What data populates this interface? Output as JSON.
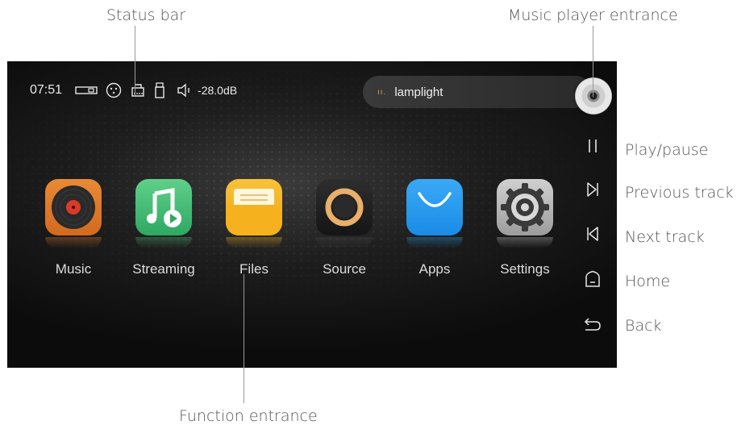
{
  "callouts": {
    "status_bar": "Status bar",
    "music_player_entrance": "Music player entrance",
    "function_entrance": "Function entrance",
    "play_pause": "Play/pause",
    "previous_track": "Previous track",
    "next_track": "Next track",
    "home": "Home",
    "back": "Back"
  },
  "status": {
    "time": "07:51",
    "icons": [
      "optical-input-icon",
      "xlr-input-icon",
      "network-icon",
      "usb-icon",
      "volume-icon"
    ],
    "volume": "-28.0dB"
  },
  "player": {
    "track": "lamplight",
    "eq_glyph": "ıı."
  },
  "apps": [
    {
      "label": "Music",
      "icon": "vinyl-record-icon",
      "color": "#e07a2a"
    },
    {
      "label": "Streaming",
      "icon": "music-note-play-icon",
      "color": "#4cbf7a"
    },
    {
      "label": "Files",
      "icon": "folder-icon",
      "color": "#f2b21c"
    },
    {
      "label": "Source",
      "icon": "ring-icon",
      "color": "#222222"
    },
    {
      "label": "Apps",
      "icon": "shopping-bag-icon",
      "color": "#2a9ff0"
    },
    {
      "label": "Settings",
      "icon": "gear-icon",
      "color": "#bdbdbd"
    }
  ],
  "controls": [
    "pause-icon",
    "next-track-icon",
    "previous-track-icon",
    "home-icon",
    "back-icon"
  ]
}
